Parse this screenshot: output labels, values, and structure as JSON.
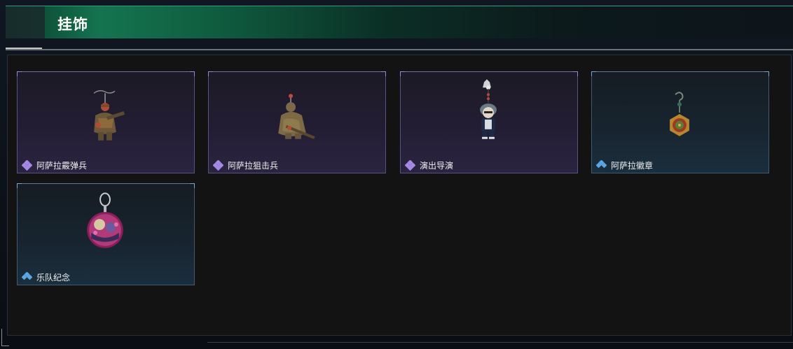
{
  "header": {
    "title": "挂饰"
  },
  "colors": {
    "accent_green": "#14744f",
    "rarity_purple": "#9b7fe0",
    "rarity_blue": "#5aa7e6"
  },
  "items": [
    {
      "name": "阿萨拉霰弹兵",
      "rarity": "purple",
      "icon": "soldier-charm-icon"
    },
    {
      "name": "阿萨拉狙击兵",
      "rarity": "purple",
      "icon": "sniper-charm-icon"
    },
    {
      "name": "演出导演",
      "rarity": "purple",
      "icon": "director-charm-icon"
    },
    {
      "name": "阿萨拉徽章",
      "rarity": "blue",
      "icon": "badge-charm-icon"
    },
    {
      "name": "乐队纪念",
      "rarity": "blue",
      "icon": "band-pin-charm-icon"
    }
  ]
}
